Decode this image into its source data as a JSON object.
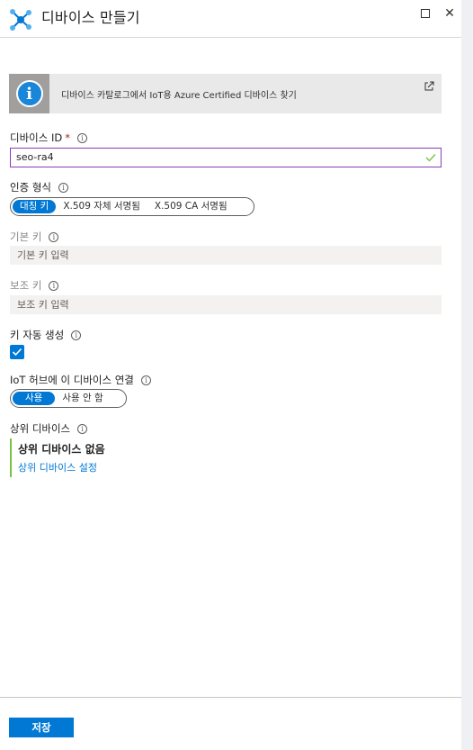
{
  "header": {
    "title": "디바이스 만들기",
    "icon": "iot-hub-icon",
    "maximize_icon": "maximize-icon",
    "close_label": "✕"
  },
  "banner": {
    "icon": "info-icon",
    "icon_glyph": "i",
    "text": "디바이스 카탈로그에서 IoT용 Azure Certified 디바이스 찾기",
    "link_icon": "external-link-icon"
  },
  "device_id": {
    "label": "디바이스 ID",
    "required_mark": "*",
    "value": "seo-ra4",
    "valid_icon": "checkmark-icon"
  },
  "auth_type": {
    "label": "인증 형식",
    "options": [
      "대칭 키",
      "X.509 자체 서명됨",
      "X.509 CA 서명됨"
    ],
    "selected": "대칭 키"
  },
  "primary_key": {
    "label": "기본 키",
    "placeholder": "기본 키 입력"
  },
  "secondary_key": {
    "label": "보조 키",
    "placeholder": "보조 키 입력"
  },
  "auto_generate": {
    "label": "키 자동 생성",
    "checked": true
  },
  "connect_hub": {
    "label": "IoT 허브에 이 디바이스 연결",
    "options": [
      "사용",
      "사용 안 함"
    ],
    "selected": "사용"
  },
  "parent_device": {
    "label": "상위 디바이스",
    "value": "상위 디바이스 없음",
    "link": "상위 디바이스 설정"
  },
  "tooltip_glyph": "i",
  "footer": {
    "save_label": "저장"
  },
  "colors": {
    "accent": "#0078d4",
    "focus_border": "#8a3cba",
    "valid_green": "#7bc142",
    "required_red": "#a4262c"
  }
}
